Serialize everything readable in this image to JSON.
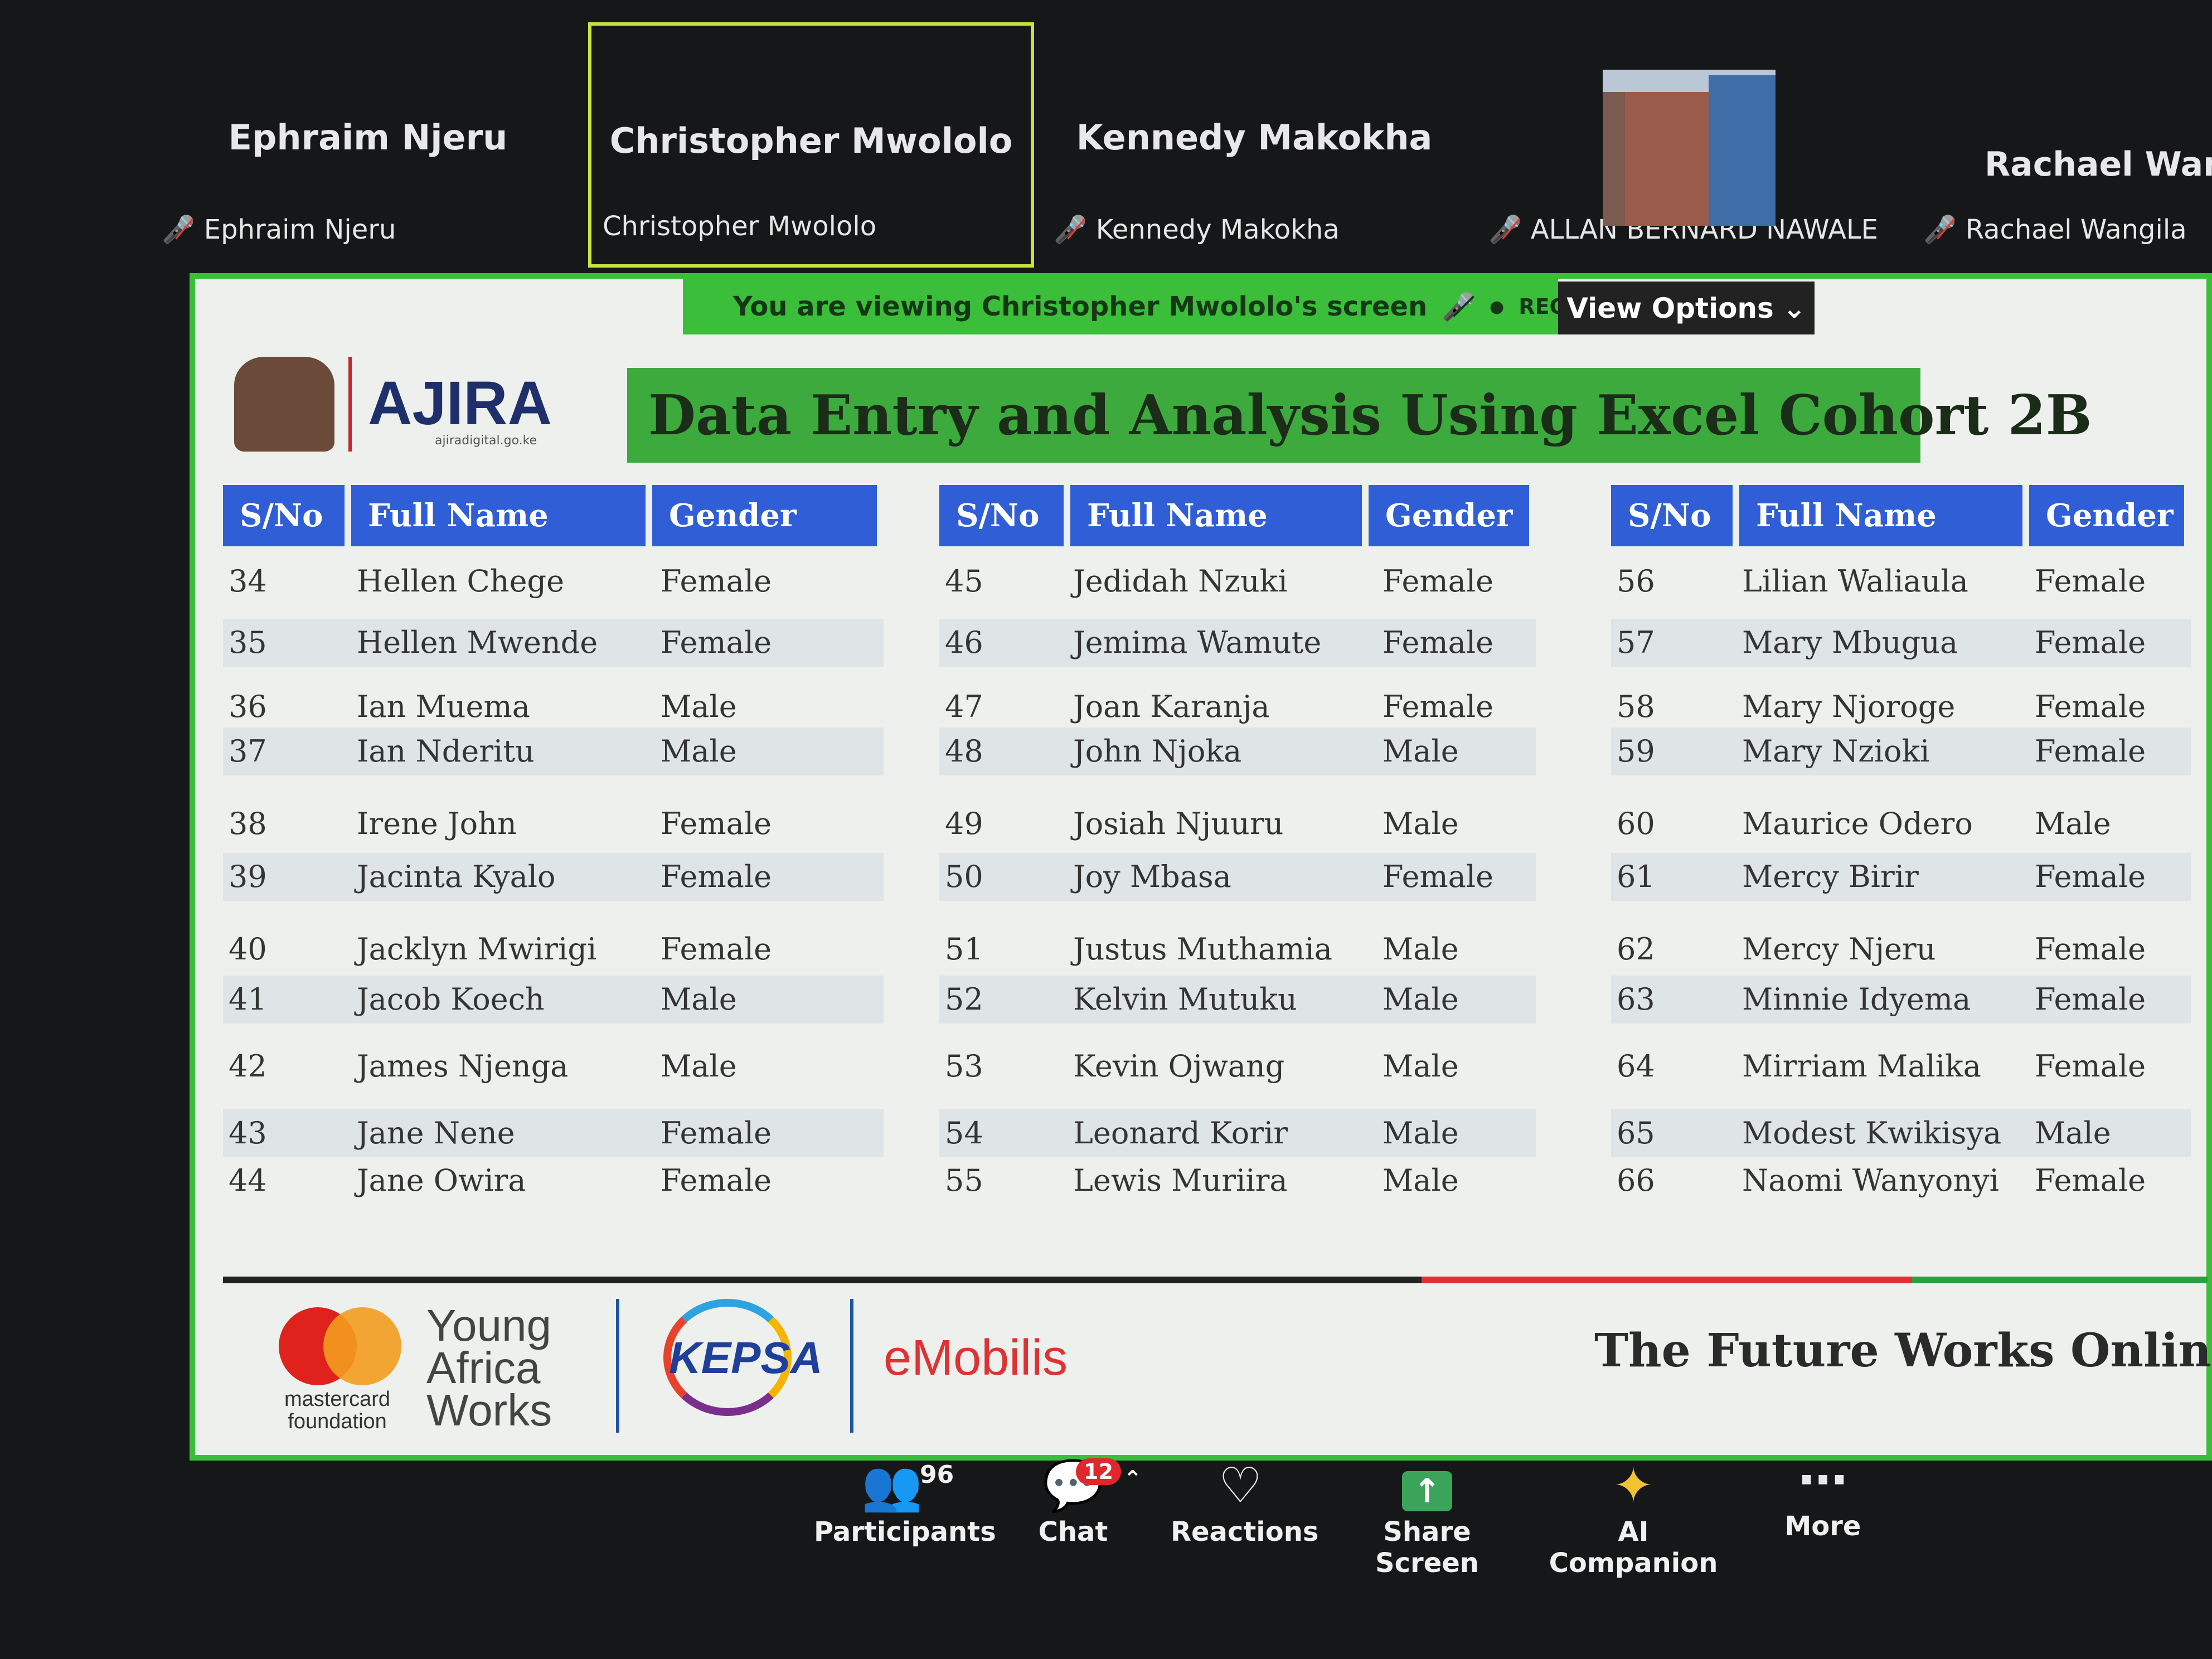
{
  "participants_strip": [
    {
      "display": "Ephraim Njeru",
      "label": "Ephraim Njeru",
      "muted": true
    },
    {
      "display": "Christopher Mwololo",
      "label": "Christopher Mwololo",
      "muted": false,
      "active": true
    },
    {
      "display": "Kennedy Makokha",
      "label": "Kennedy Makokha",
      "muted": true
    },
    {
      "display": "",
      "label": "ALLAN BERNARD NAWALE",
      "muted": true
    },
    {
      "display": "Rachael Wang",
      "label": "Rachael Wangila",
      "muted": true
    }
  ],
  "share_bar": {
    "viewing_text": "You are viewing  Christopher Mwololo's screen",
    "rec": "REC",
    "view_options": "View Options"
  },
  "slide": {
    "logo_text": "AJIRA",
    "logo_sub": "ajiradigital.go.ke",
    "title": "Data Entry and Analysis Using Excel Cohort 2B",
    "headers": {
      "sno": "S/No",
      "name": "Full Name",
      "gender": "Gender"
    },
    "columns": [
      [
        [
          "34",
          "Hellen Chege",
          "Female"
        ],
        [
          "35",
          "Hellen Mwende",
          "Female"
        ],
        [
          "36",
          "Ian Muema",
          "Male"
        ],
        [
          "37",
          "Ian Nderitu",
          "Male"
        ],
        [
          "38",
          "Irene John",
          "Female"
        ],
        [
          "39",
          "Jacinta Kyalo",
          "Female"
        ],
        [
          "40",
          "Jacklyn Mwirigi",
          "Female"
        ],
        [
          "41",
          "Jacob Koech",
          "Male"
        ],
        [
          "42",
          "James Njenga",
          "Male"
        ],
        [
          "43",
          "Jane Nene",
          "Female"
        ],
        [
          "44",
          "Jane Owira",
          "Female"
        ]
      ],
      [
        [
          "45",
          "Jedidah Nzuki",
          "Female"
        ],
        [
          "46",
          "Jemima Wamute",
          "Female"
        ],
        [
          "47",
          "Joan Karanja",
          "Female"
        ],
        [
          "48",
          "John Njoka",
          "Male"
        ],
        [
          "49",
          "Josiah Njuuru",
          "Male"
        ],
        [
          "50",
          "Joy Mbasa",
          "Female"
        ],
        [
          "51",
          "Justus Muthamia",
          "Male"
        ],
        [
          "52",
          "Kelvin Mutuku",
          "Male"
        ],
        [
          "53",
          "Kevin Ojwang",
          "Male"
        ],
        [
          "54",
          "Leonard Korir",
          "Male"
        ],
        [
          "55",
          "Lewis Muriira",
          "Male"
        ]
      ],
      [
        [
          "56",
          "Lilian Waliaula",
          "Female"
        ],
        [
          "57",
          "Mary Mbugua",
          "Female"
        ],
        [
          "58",
          "Mary Njoroge",
          "Female"
        ],
        [
          "59",
          "Mary Nzioki",
          "Female"
        ],
        [
          "60",
          "Maurice Odero",
          "Male"
        ],
        [
          "61",
          "Mercy Birir",
          "Female"
        ],
        [
          "62",
          "Mercy Njeru",
          "Female"
        ],
        [
          "63",
          "Minnie Idyema",
          "Female"
        ],
        [
          "64",
          "Mirriam Malika",
          "Female"
        ],
        [
          "65",
          "Modest Kwikisya",
          "Male"
        ],
        [
          "66",
          "Naomi Wanyonyi",
          "Female"
        ]
      ]
    ],
    "footer": {
      "young_africa_works": [
        "Young",
        "Africa",
        "Works"
      ],
      "mastercard_foundation": [
        "mastercard",
        "foundation"
      ],
      "kepsa": "KEPSA",
      "emobilis": "eMobilis",
      "tagline": "The Future Works Online"
    }
  },
  "toolbar": {
    "participants_label": "Participants",
    "participants_count": "96",
    "chat_label": "Chat",
    "chat_badge": "12",
    "reactions_label": "Reactions",
    "share_label": "Share Screen",
    "ai_label": "AI Companion",
    "more_label": "More"
  },
  "colors": {
    "accent_green": "#3bbf3b",
    "header_blue": "#2f5ed6",
    "badge_red": "#e0282c"
  }
}
